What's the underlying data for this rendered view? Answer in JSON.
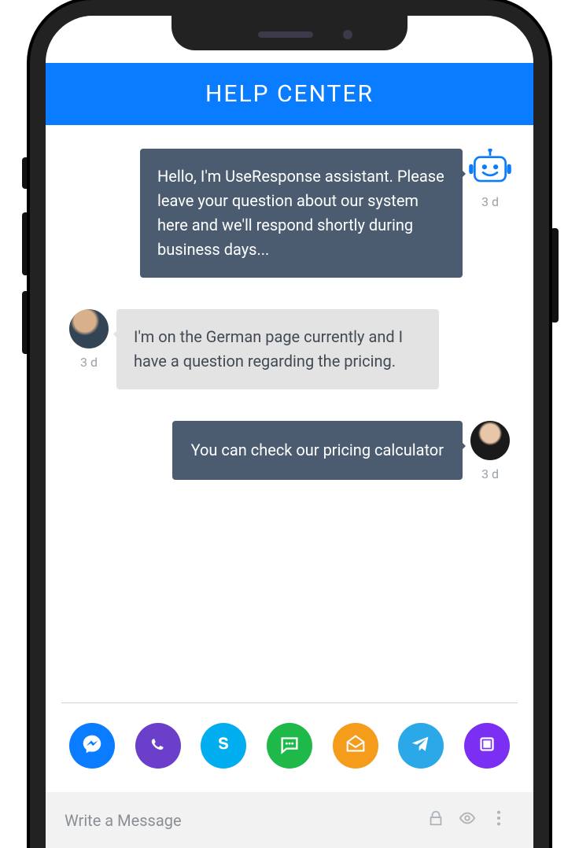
{
  "header": {
    "title": "HELP CENTER"
  },
  "messages": [
    {
      "side": "right",
      "bubble_style": "dark",
      "author": "bot",
      "text": "Hello, I'm UseResponse assistant. Please leave your question about our system here and we'll respond shortly during business days...",
      "timestamp": "3 d"
    },
    {
      "side": "left",
      "bubble_style": "light",
      "author": "user",
      "text": "I'm on the German page currently and I have a question regarding the pricing.",
      "timestamp": "3 d"
    },
    {
      "side": "right",
      "bubble_style": "dark",
      "author": "agent",
      "text": "You can check our pricing calculator",
      "timestamp": "3 d"
    }
  ],
  "channels": [
    {
      "name": "messenger",
      "color": "#0a7cff"
    },
    {
      "name": "viber",
      "color": "#6b3fc9"
    },
    {
      "name": "skype",
      "color": "#00aeef"
    },
    {
      "name": "sms",
      "color": "#1fb94a"
    },
    {
      "name": "email",
      "color": "#f59c1a"
    },
    {
      "name": "telegram",
      "color": "#2aa8e8"
    },
    {
      "name": "other",
      "color": "#7b2ff2"
    }
  ],
  "input": {
    "placeholder": "Write a Message",
    "tools": [
      "lock",
      "visibility",
      "more"
    ]
  }
}
